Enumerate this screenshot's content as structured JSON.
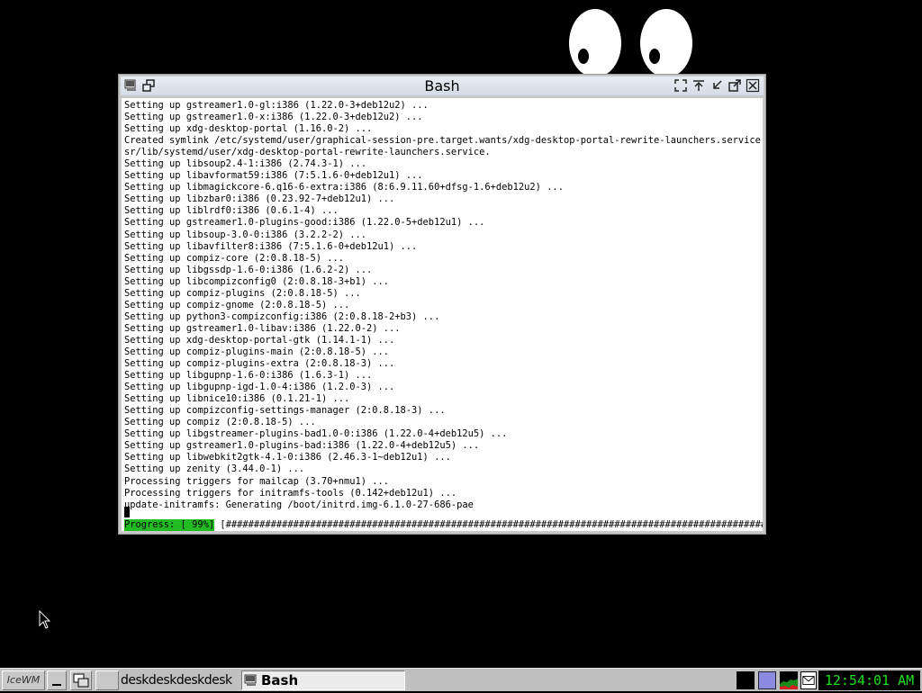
{
  "window": {
    "title": "Bash",
    "terminal_lines": [
      "Setting up gstreamer1.0-gl:i386 (1.22.0-3+deb12u2) ...",
      "Setting up gstreamer1.0-x:i386 (1.22.0-3+deb12u2) ...",
      "Setting up xdg-desktop-portal (1.16.0-2) ...",
      "Created symlink /etc/systemd/user/graphical-session-pre.target.wants/xdg-desktop-portal-rewrite-launchers.service → /u",
      "sr/lib/systemd/user/xdg-desktop-portal-rewrite-launchers.service.",
      "Setting up libsoup2.4-1:i386 (2.74.3-1) ...",
      "Setting up libavformat59:i386 (7:5.1.6-0+deb12u1) ...",
      "Setting up libmagickcore-6.q16-6-extra:i386 (8:6.9.11.60+dfsg-1.6+deb12u2) ...",
      "Setting up libzbar0:i386 (0.23.92-7+deb12u1) ...",
      "Setting up liblrdf0:i386 (0.6.1-4) ...",
      "Setting up gstreamer1.0-plugins-good:i386 (1.22.0-5+deb12u1) ...",
      "Setting up libsoup-3.0-0:i386 (3.2.2-2) ...",
      "Setting up libavfilter8:i386 (7:5.1.6-0+deb12u1) ...",
      "Setting up compiz-core (2:0.8.18-5) ...",
      "Setting up libgssdp-1.6-0:i386 (1.6.2-2) ...",
      "Setting up libcompizconfig0 (2:0.8.18-3+b1) ...",
      "Setting up compiz-plugins (2:0.8.18-5) ...",
      "Setting up compiz-gnome (2:0.8.18-5) ...",
      "Setting up python3-compizconfig:i386 (2:0.8.18-2+b3) ...",
      "Setting up gstreamer1.0-libav:i386 (1.22.0-2) ...",
      "Setting up xdg-desktop-portal-gtk (1.14.1-1) ...",
      "Setting up compiz-plugins-main (2:0.8.18-5) ...",
      "Setting up compiz-plugins-extra (2:0.8.18-3) ...",
      "Setting up libgupnp-1.6-0:i386 (1.6.3-1) ...",
      "Setting up libgupnp-igd-1.0-4:i386 (1.2.0-3) ...",
      "Setting up libnice10:i386 (0.1.21-1) ...",
      "Setting up compizconfig-settings-manager (2:0.8.18-3) ...",
      "Setting up compiz (2:0.8.18-5) ...",
      "Setting up libgstreamer-plugins-bad1.0-0:i386 (1.22.0-4+deb12u5) ...",
      "Setting up gstreamer1.0-plugins-bad:i386 (1.22.0-4+deb12u5) ...",
      "Setting up libwebkit2gtk-4.1-0:i386 (2.46.3-1~deb12u1) ...",
      "Setting up zenity (3.44.0-1) ...",
      "Processing triggers for mailcap (3.70+nmu1) ...",
      "Processing triggers for initramfs-tools (0.142+deb12u1) ...",
      "update-initramfs: Generating /boot/initrd.img-6.1.0-27-686-pae"
    ],
    "progress_label": "Progress: [ 99%]",
    "progress_percent": 99,
    "progress_bar": " [######################################################################################################.]"
  },
  "taskbar": {
    "start_label": "IceWM",
    "workspaces": [
      "desk",
      "desk",
      "desk",
      "desk"
    ],
    "task_label": "Bash",
    "clock": "12:54:01 AM"
  },
  "colors": {
    "desktop": "#000000",
    "progress_label_bg": "#22bb22",
    "clock_fg": "#1fe01f",
    "titlebar": "#dfe4ee"
  },
  "icons": {
    "window_menu": "window-menu-icon",
    "restore_small": "restore-small-icon",
    "fullscreen": "fullscreen-icon",
    "rollup": "rollup-icon",
    "minimize": "minimize-icon",
    "maximize": "maximize-icon",
    "close": "close-icon"
  }
}
